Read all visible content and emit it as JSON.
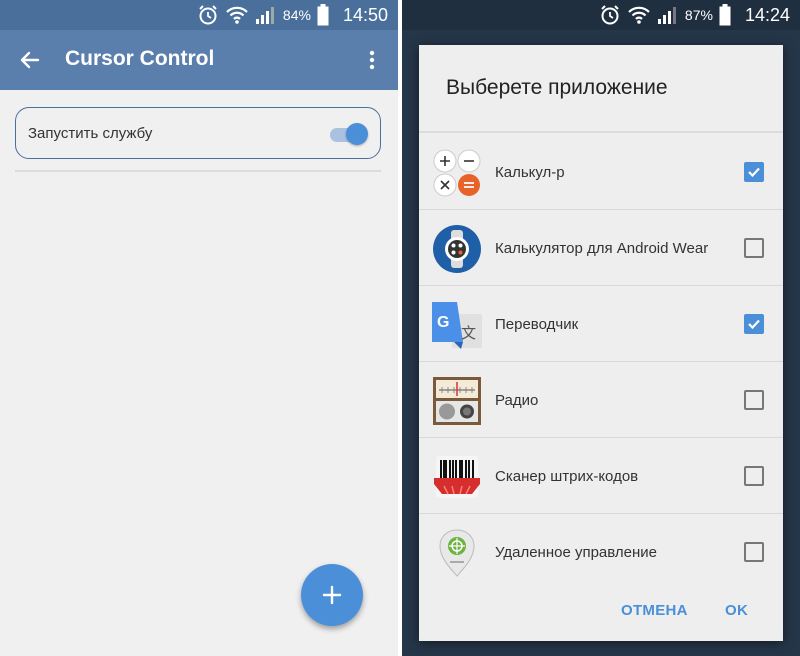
{
  "left_screen": {
    "status": {
      "battery": "84%",
      "time": "14:50"
    },
    "appbar": {
      "title": "Cursor Control"
    },
    "service": {
      "label": "Запустить службу",
      "enabled": true
    },
    "fab": {
      "label": "+"
    }
  },
  "right_screen": {
    "status": {
      "battery": "87%",
      "time": "14:24"
    },
    "dialog": {
      "title": "Выберете приложение",
      "items": [
        {
          "label": "Калькул-р",
          "icon": "calculator-icon",
          "checked": true
        },
        {
          "label": "Калькулятор для Android Wear",
          "icon": "android-wear-calculator-icon",
          "checked": false
        },
        {
          "label": "Переводчик",
          "icon": "translate-icon",
          "checked": true
        },
        {
          "label": "Радио",
          "icon": "radio-icon",
          "checked": false
        },
        {
          "label": "Сканер штрих-кодов",
          "icon": "barcode-scanner-icon",
          "checked": false
        },
        {
          "label": "Удаленное управление",
          "icon": "remote-control-icon",
          "checked": false
        }
      ],
      "cancel_label": "ОТМЕНА",
      "ok_label": "OK"
    }
  },
  "colors": {
    "appbar": "#5a7fad",
    "accent": "#4a8fd8",
    "dialog_bg": "#eeeeee",
    "dim_background": "#253648"
  }
}
